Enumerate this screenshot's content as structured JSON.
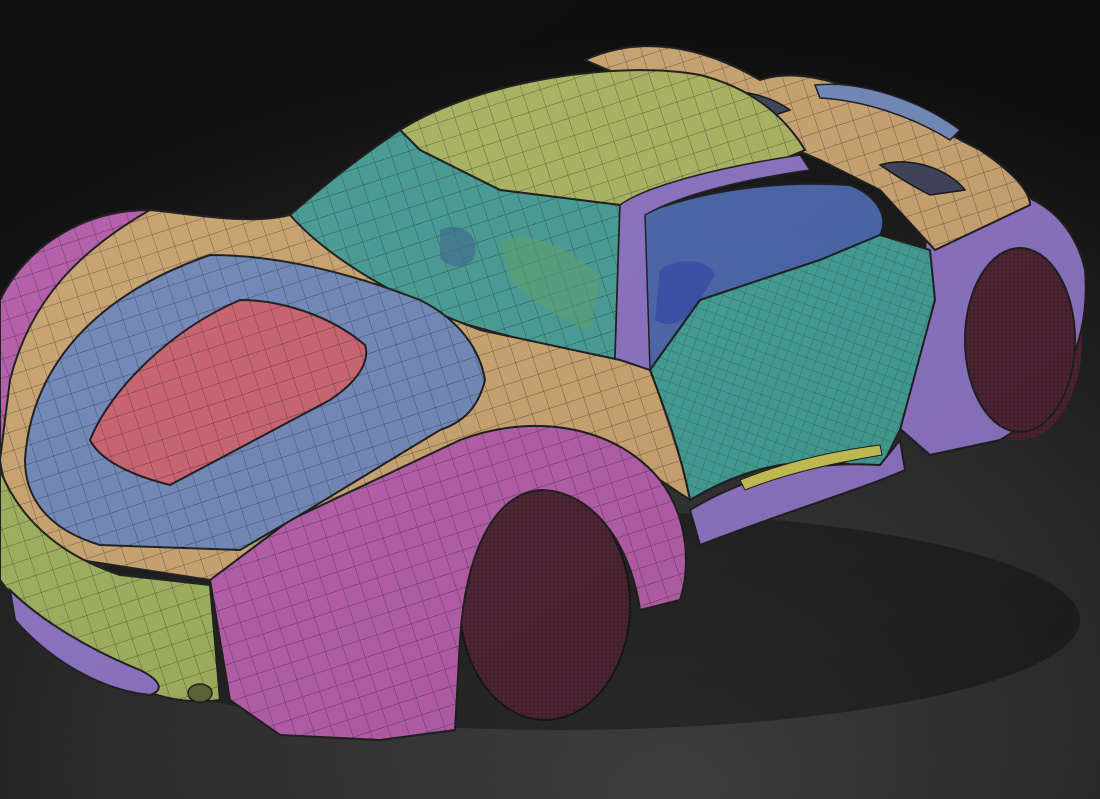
{
  "scene": {
    "subject": "car-3d-polygroup-model",
    "colors": {
      "background_top": "#050505",
      "background_bottom": "#3a3a3a",
      "polygroup_magenta": "#b35aa8",
      "polygroup_tan": "#c9a26e",
      "polygroup_blue": "#6f86b8",
      "polygroup_red": "#c9606e",
      "polygroup_yellow_green": "#a9b35f",
      "polygroup_teal": "#3f9c92",
      "polygroup_violet": "#8a6fc0",
      "polygroup_lime": "#9cae5a",
      "glass_teal": "#49a9a0",
      "wheel_dark": "#4a2030",
      "wireframe": "#1a1a1a"
    }
  }
}
